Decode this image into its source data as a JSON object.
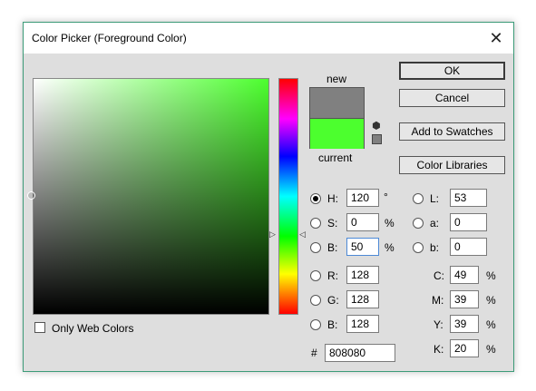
{
  "window": {
    "title": "Color Picker (Foreground Color)"
  },
  "labels": {
    "new": "new",
    "current": "current",
    "only_web_colors": "Only Web Colors",
    "hash": "#"
  },
  "colors": {
    "new": "#808080",
    "current": "#4cff2e",
    "hue_top": "#ff0000"
  },
  "buttons": {
    "ok": "OK",
    "cancel": "Cancel",
    "add_swatches": "Add to Swatches",
    "color_libraries": "Color Libraries"
  },
  "hsb": {
    "h": {
      "label": "H:",
      "value": "120",
      "unit": "°"
    },
    "s": {
      "label": "S:",
      "value": "0",
      "unit": "%"
    },
    "b": {
      "label": "B:",
      "value": "50",
      "unit": "%"
    }
  },
  "rgb": {
    "r": {
      "label": "R:",
      "value": "128"
    },
    "g": {
      "label": "G:",
      "value": "128"
    },
    "b": {
      "label": "B:",
      "value": "128"
    }
  },
  "lab": {
    "l": {
      "label": "L:",
      "value": "53"
    },
    "a": {
      "label": "a:",
      "value": "0"
    },
    "b": {
      "label": "b:",
      "value": "0"
    }
  },
  "cmyk": {
    "c": {
      "label": "C:",
      "value": "49",
      "unit": "%"
    },
    "m": {
      "label": "M:",
      "value": "39",
      "unit": "%"
    },
    "y": {
      "label": "Y:",
      "value": "39",
      "unit": "%"
    },
    "k": {
      "label": "K:",
      "value": "20",
      "unit": "%"
    }
  },
  "hex": {
    "value": "808080"
  },
  "icons": {
    "close": "close-icon",
    "cube": "web-safe-cube-icon",
    "gamut": "gamut-swatch-icon",
    "slider": "slider-arrow-icon"
  }
}
